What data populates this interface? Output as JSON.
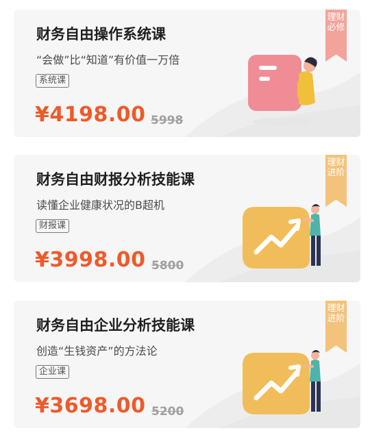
{
  "courses": [
    {
      "title": "财务自由操作系统课",
      "subtitle": "“会做”比“知道”有价值一万倍",
      "tag": "系统课",
      "price": "¥4198.00",
      "original_price": "5998",
      "ribbon": "理财必修",
      "ribbon_color": "#f2a39a",
      "illustration": "document-person-icon"
    },
    {
      "title": "财务自由财报分析技能课",
      "subtitle": "读懂企业健康状况的B超机",
      "tag": "财报课",
      "price": "¥3998.00",
      "original_price": "5800",
      "ribbon": "理财进阶",
      "ribbon_color": "#f3c27b",
      "illustration": "trend-chart-person-icon"
    },
    {
      "title": "财务自由企业分析技能课",
      "subtitle": "创造“生钱资产”的方法论",
      "tag": "企业课",
      "price": "¥3698.00",
      "original_price": "5200",
      "ribbon": "理财进阶",
      "ribbon_color": "#f3c27b",
      "illustration": "trend-chart-person-icon"
    }
  ],
  "colors": {
    "price": "#ef5a2a",
    "card_background": "#f6f6f6"
  }
}
